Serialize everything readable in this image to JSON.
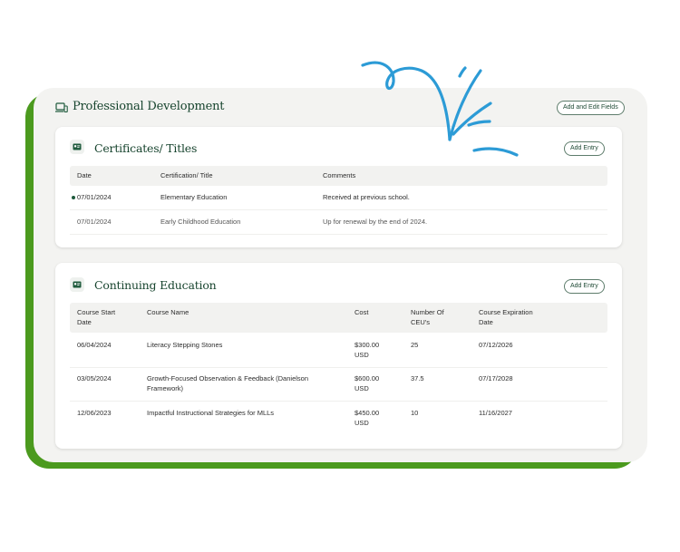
{
  "professional_development": {
    "title": "Professional Development",
    "add_edit_fields_label": "Add and Edit Fields"
  },
  "certificates": {
    "title": "Certificates/ Titles",
    "add_entry_label": "Add Entry",
    "columns": [
      "Date",
      "Certification/ Title",
      "Comments"
    ],
    "rows": [
      {
        "date": "07/01/2024",
        "title": "Elementary Education",
        "comments": "Received at previous school."
      },
      {
        "date": "07/01/2024",
        "title": "Early Childhood Education",
        "comments": "Up for renewal by the end of 2024."
      }
    ]
  },
  "continuing_education": {
    "title": "Continuing Education",
    "add_entry_label": "Add Entry",
    "columns": [
      "Course Start Date",
      "Course Name",
      "Cost",
      "Number Of CEU's",
      "Course Expiration Date"
    ],
    "rows": [
      {
        "start": "06/04/2024",
        "name": "Literacy Stepping Stones",
        "cost": "$300.00 USD",
        "ceus": "25",
        "expiration": "07/12/2026"
      },
      {
        "start": "03/05/2024",
        "name": "Growth-Focused Observation & Feedback (Danielson Framework)",
        "cost": "$600.00 USD",
        "ceus": "37.5",
        "expiration": "07/17/2028"
      },
      {
        "start": "12/06/2023",
        "name": "Impactful Instructional Strategies for MLLs",
        "cost": "$450.00 USD",
        "ceus": "10",
        "expiration": "11/16/2027"
      }
    ]
  },
  "colors": {
    "brand_green": "#4b9a1e",
    "title_green": "#17442e",
    "scribble_blue": "#2c9bd6"
  },
  "icons": [
    "devices-icon",
    "id-card-icon",
    "scribble-decoration"
  ]
}
